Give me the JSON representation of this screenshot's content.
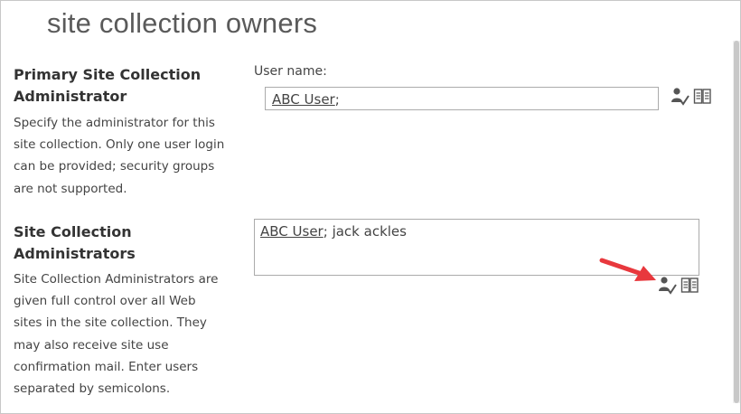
{
  "page": {
    "title": "site collection owners"
  },
  "primary": {
    "heading_line1": "Primary Site Collection",
    "heading_line2": "Administrator",
    "desc_lines": [
      "Specify the administrator for this",
      "site collection. Only one user login",
      "can be provided; security groups",
      "are not supported."
    ],
    "field_label": "User name:",
    "resolved_user": "ABC User",
    "separator": ";",
    "check_names_icon": "check-names-icon",
    "browse_icon": "address-book-icon"
  },
  "admins": {
    "heading_line1": "Site Collection",
    "heading_line2": "Administrators",
    "desc_lines": [
      "Site Collection Administrators are",
      "given full control over all Web",
      "sites in the site collection. They",
      "may also receive site use",
      "confirmation mail. Enter users",
      "separated by semicolons."
    ],
    "resolved_user": "ABC User",
    "separator": ";",
    "unresolved_text": " jack ackles",
    "check_names_icon": "check-names-icon",
    "browse_icon": "address-book-icon"
  },
  "colors": {
    "annotation_arrow": "#e8383d"
  }
}
